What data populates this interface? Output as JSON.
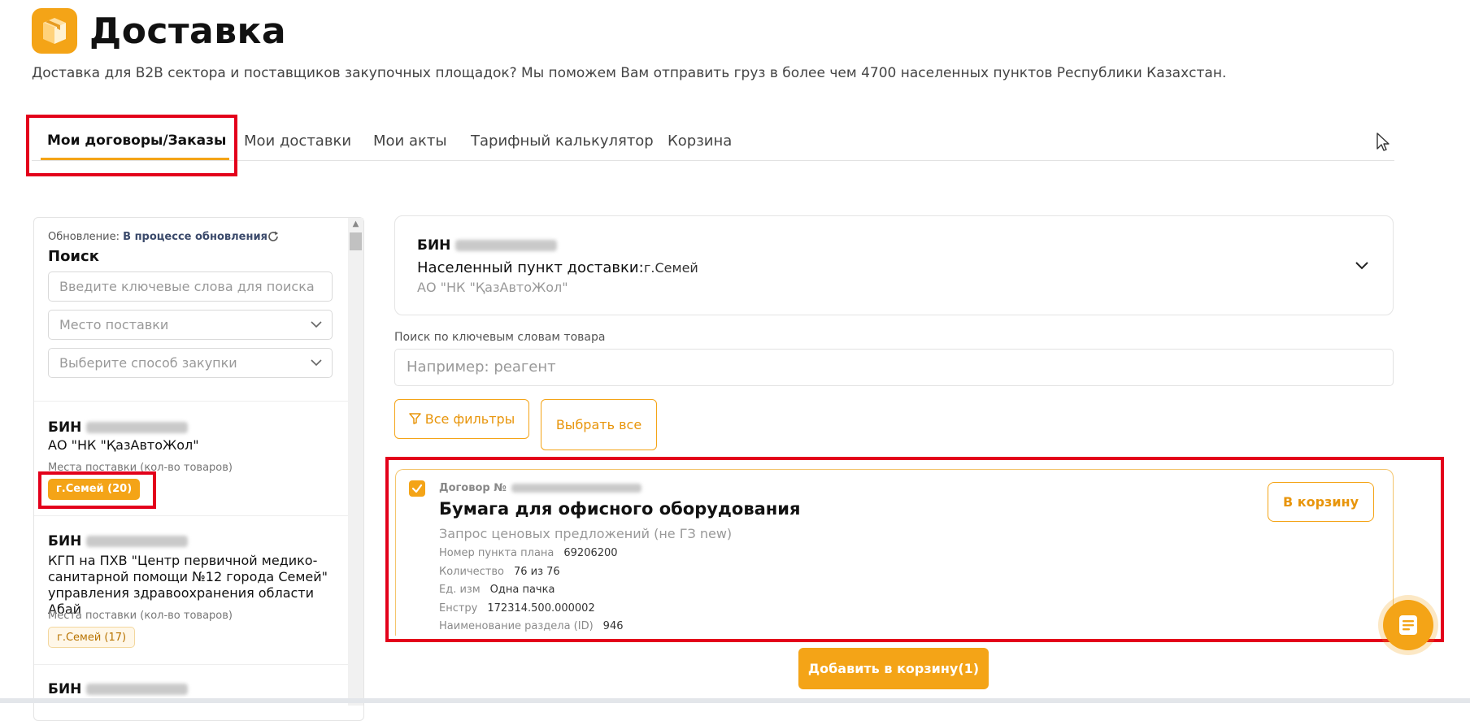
{
  "header": {
    "title": "Доставка",
    "subtitle": "Доставка для B2B сектора и поставщиков закупочных площадок? Мы поможем Вам отправить груз в более чем 4700 населенных пунктов Республики Казахстан."
  },
  "tabs": [
    {
      "label": "Мои договоры/Заказы",
      "active": true
    },
    {
      "label": "Мои доставки"
    },
    {
      "label": "Мои акты"
    },
    {
      "label": "Тарифный калькулятор"
    },
    {
      "label": "Корзина"
    }
  ],
  "sidebar": {
    "update_label": "Обновление:",
    "update_status": "В процессе обновления",
    "search_title": "Поиск",
    "search_placeholder": "Введите ключевые слова для поиска",
    "place_placeholder": "Место поставки",
    "method_placeholder": "Выберите способ закупки",
    "customers": [
      {
        "bin_label": "БИН",
        "org": "АО \"НК \"ҚазАвтоЖол\"",
        "places_label": "Места поставки (кол-во товаров)",
        "chip": "г.Семей (20)"
      },
      {
        "bin_label": "БИН",
        "org": "КГП на ПХВ \"Центр первичной медико-санитарной помощи №12 города Семей\" управления здравоохранения области Абай",
        "places_label": "Места поставки (кол-во товаров)",
        "chip": "г.Семей (17)"
      },
      {
        "bin_label": "БИН"
      }
    ]
  },
  "contract": {
    "bin_label": "БИН",
    "city_label": "Населенный пункт доставки:",
    "city_value": "г.Семей",
    "org": "АО \"НК \"ҚазАвтоЖол\""
  },
  "keyword_search": {
    "label": "Поиск по ключевым словам товара",
    "placeholder": "Например: реагент"
  },
  "buttons": {
    "filters": "Все фильтры",
    "select_all": "Выбрать все",
    "to_cart": "В корзину",
    "add_to_cart": "Добавить в корзину(1)"
  },
  "item": {
    "contract_label": "Договор №",
    "title": "Бумага для офисного оборудования",
    "method": "Запрос ценовых предложений (не ГЗ new)",
    "checked": true,
    "rows": [
      {
        "label": "Номер пункта плана",
        "value": "69206200"
      },
      {
        "label": "Количество",
        "value": "76 из 76"
      },
      {
        "label": "Ед. изм",
        "value": "Одна пачка"
      },
      {
        "label": "Енстру",
        "value": "172314.500.000002"
      },
      {
        "label": "Наименование раздела (ID)",
        "value": "946"
      }
    ]
  },
  "colors": {
    "accent": "#f4a417",
    "highlight": "#e3001b"
  },
  "icons": {
    "logo": "box-icon",
    "refresh": "refresh-icon",
    "chevron": "chevron-down-icon",
    "filter": "filter-icon",
    "check": "check-icon",
    "chat": "chat-icon",
    "cursor": "cursor-icon"
  }
}
